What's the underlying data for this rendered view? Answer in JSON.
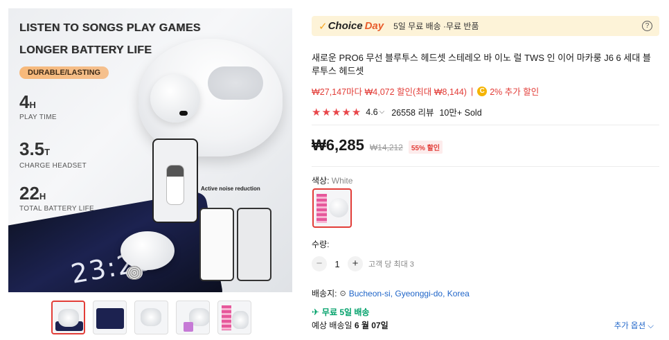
{
  "gallery": {
    "overlay": {
      "line1": "LISTEN TO SONGS PLAY GAMES",
      "line2": "LONGER BATTERY LIFE",
      "badge": "DURABLE/LASTING",
      "stat1_value": "4",
      "stat1_unit": "H",
      "stat1_caption": "PLAY TIME",
      "stat2_value": "3.5",
      "stat2_unit": "T",
      "stat2_caption": "CHARGE HEADSET",
      "stat3_value": "22",
      "stat3_unit": "H",
      "stat3_caption": "TOTAL BATTERY LIFE",
      "noise_label": "Active noise reduction",
      "clock": "23:28"
    },
    "thumbnail_count": 5
  },
  "choice_bar": {
    "check": "✓",
    "choice": "Choice",
    "day": "Day",
    "info": "5일 무료 배송 ·무료 반품",
    "help": "?"
  },
  "product": {
    "title": "새로운 PRO6 무선 블루투스 헤드셋 스테레오 바 이노 럴 TWS 인 이어 마카룽 J6 6 세대 블루투스 헤드셋",
    "coupon_text": "₩27,147마다 ₩4,072 할인(최대 ₩8,144)",
    "coupon_sep": "|",
    "coin_symbol": "C",
    "extra_discount": "2% 추가 할인",
    "stars": "★★★★★",
    "rating": "4.6",
    "chevron": "⌵",
    "reviews": "26558 리뷰",
    "sold": "10만+ Sold",
    "price": "₩6,285",
    "original_price": "₩14,212",
    "discount": "55% 할인"
  },
  "options": {
    "color_label": "색상: ",
    "color_value": "White",
    "qty_label": "수량:",
    "minus": "−",
    "qty_value": "1",
    "plus": "+",
    "qty_limit": "고객 당 최대 3"
  },
  "shipping": {
    "ship_to_label": "배송지:",
    "loc_icon": "⊙",
    "location": "Bucheon-si, Gyeonggi-do, Korea",
    "truck": "✈",
    "free": "무료 5일 배송",
    "eta_prefix": "예상 배송일 ",
    "eta_date": "6 월 07일",
    "more_options": "추가 옵션 ⌵"
  },
  "colors": {
    "accent_red": "#e23c37",
    "choice_orange": "#e85d2c",
    "link_blue": "#1e64c8",
    "ship_green": "#00a16a",
    "choice_bg": "#fdf3d8"
  }
}
